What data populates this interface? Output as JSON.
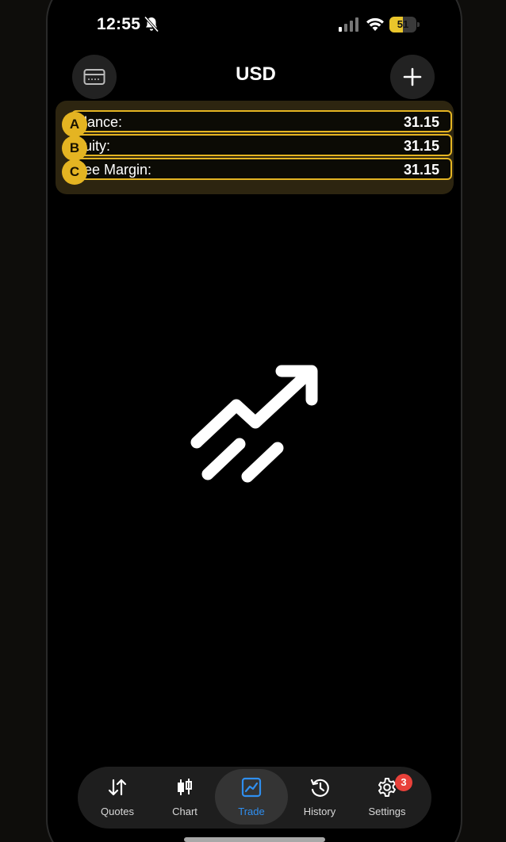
{
  "status_bar": {
    "time": "12:55",
    "battery_level": "51",
    "battery_fraction": 0.51,
    "icons": [
      "bell-slash-icon",
      "cellular-signal-icon",
      "wifi-icon",
      "battery-icon"
    ]
  },
  "header": {
    "title": "USD",
    "left_icon": "account-card-icon",
    "right_icon": "plus-icon"
  },
  "account_rows": [
    {
      "marker": "A",
      "label": "lance:",
      "value": "31.15"
    },
    {
      "marker": "B",
      "label": "uity:",
      "value": "31.15"
    },
    {
      "marker": "C",
      "label": "ee Margin:",
      "value": "31.15"
    }
  ],
  "empty_state": {
    "icon": "trend-up-arrow-icon"
  },
  "tabbar": {
    "active": "Trade",
    "tabs": [
      {
        "label": "Quotes",
        "icon": "up-down-arrows-icon"
      },
      {
        "label": "Chart",
        "icon": "candlestick-icon"
      },
      {
        "label": "Trade",
        "icon": "line-chart-icon"
      },
      {
        "label": "History",
        "icon": "clock-history-icon"
      },
      {
        "label": "Settings",
        "icon": "gear-icon",
        "badge": "3"
      }
    ]
  },
  "colors": {
    "accent": "#2f8ff0",
    "highlight": "#e4b422",
    "badge": "#e8413a",
    "background": "#000000"
  }
}
